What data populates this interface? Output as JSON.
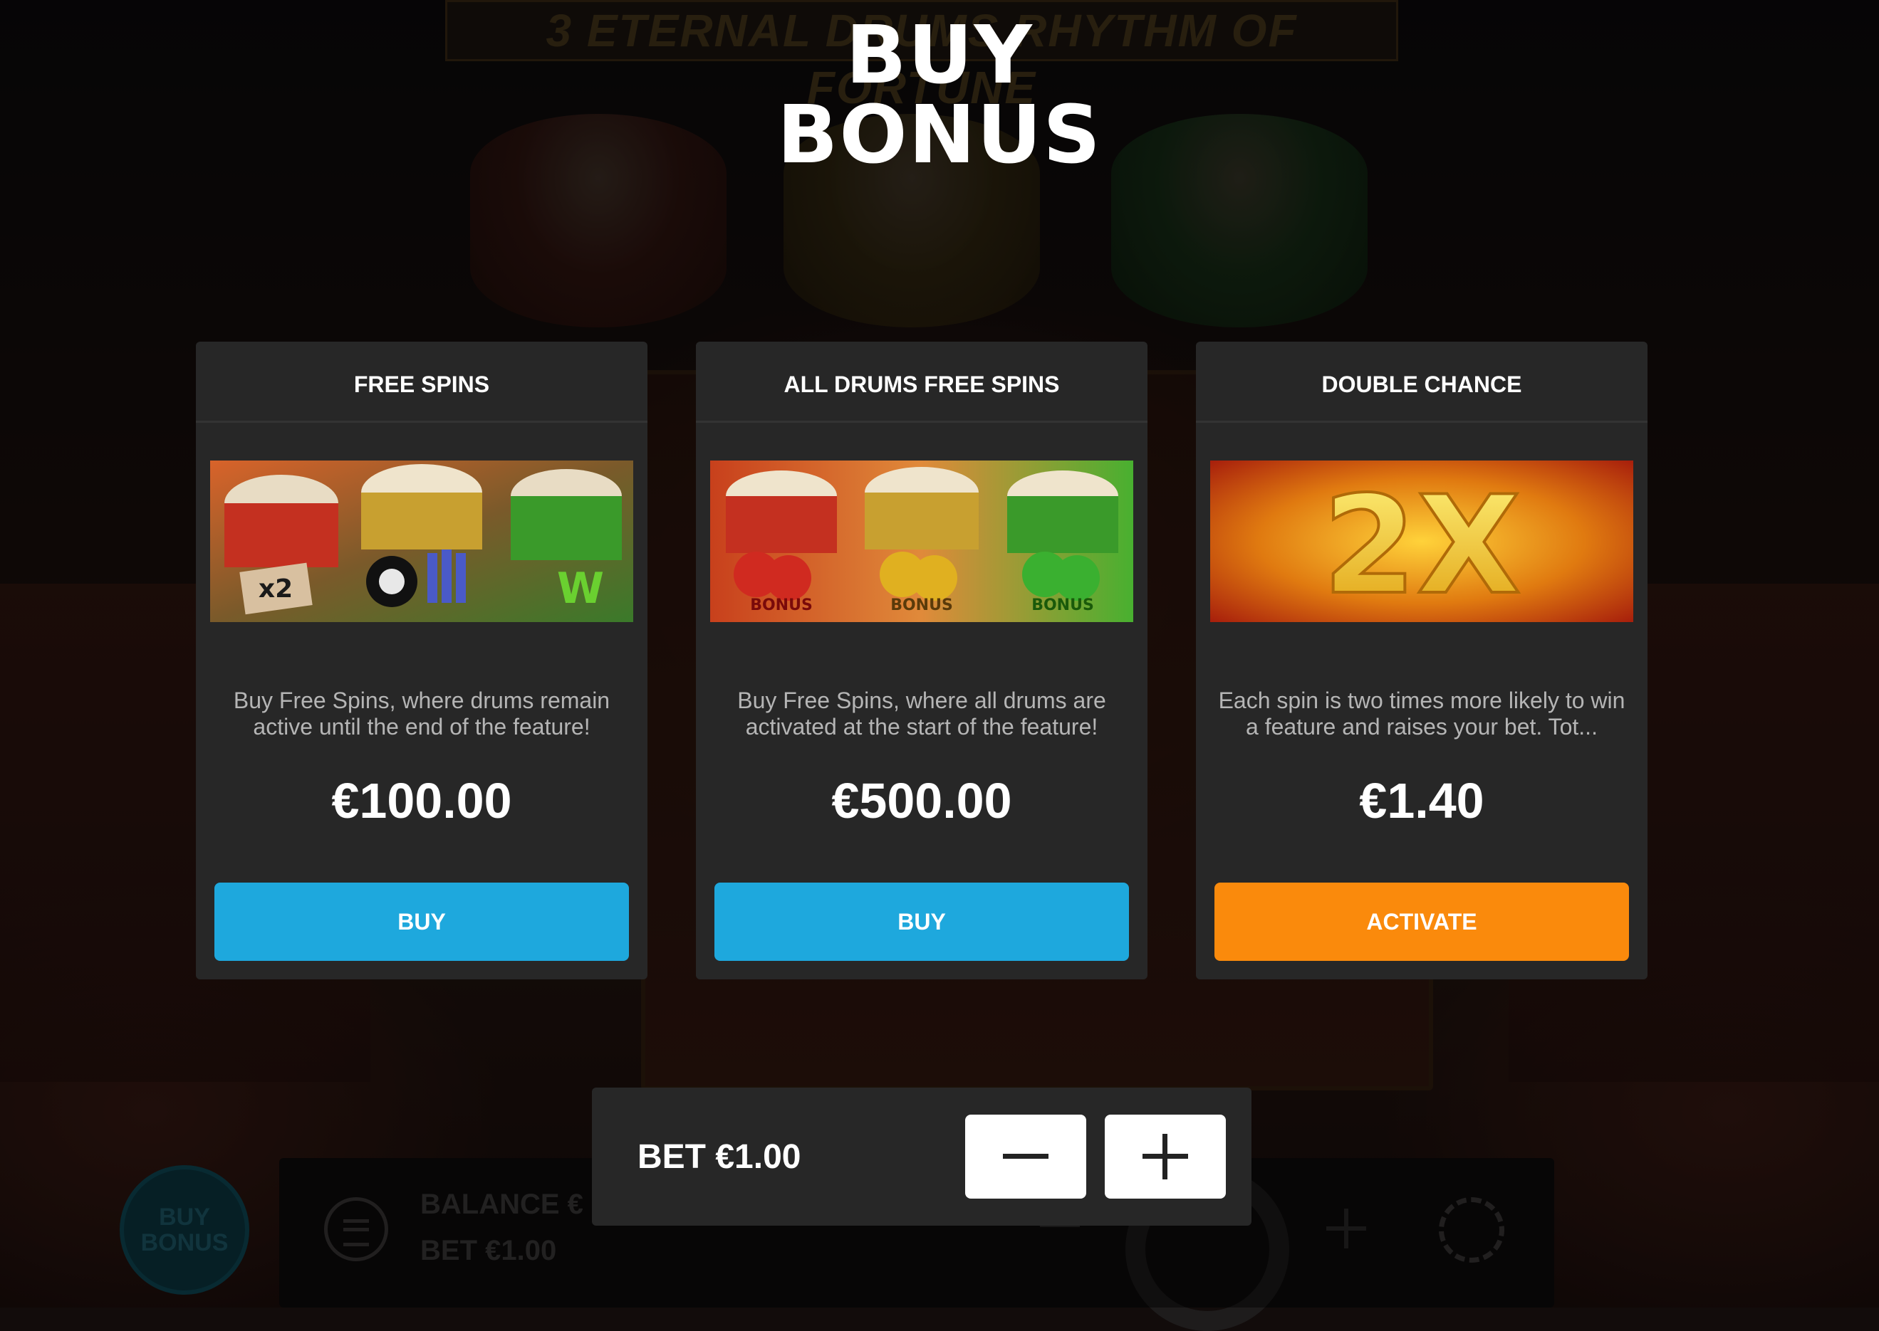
{
  "title": {
    "line1": "BUY",
    "line2": "BONUS"
  },
  "background": {
    "logo_text": "3 ETERNAL DRUMS RHYTHM OF FORTUNE",
    "buy_bonus_badge": "BUY BONUS",
    "balance_label": "BALANCE €",
    "bet_label": "BET  €1.00"
  },
  "cards": [
    {
      "title": "FREE SPINS",
      "image_text": "x2",
      "description": "Buy Free Spins, where drums remain active until the end of the feature!",
      "price": "€100.00",
      "button": "BUY",
      "button_color": "#1ea8dd"
    },
    {
      "title": "ALL DRUMS FREE SPINS",
      "image_text": "BONUS",
      "description": "Buy Free Spins, where all drums are activated at the start of the feature!",
      "price": "€500.00",
      "button": "BUY",
      "button_color": "#1ea8dd"
    },
    {
      "title": "DOUBLE CHANCE",
      "image_text": "2X",
      "description": "Each spin is two times more likely to win a feature and raises your bet. Tot...",
      "price": "€1.40",
      "button": "ACTIVATE",
      "button_color": "#fa8a0c"
    }
  ],
  "bet_panel": {
    "label": "BET €1.00",
    "minus_icon": "minus-icon",
    "plus_icon": "plus-icon"
  },
  "colors": {
    "card_bg": "#272727",
    "buy_blue": "#1ea8dd",
    "activate_orange": "#fa8a0c",
    "description_gray": "#b5b5b5"
  }
}
